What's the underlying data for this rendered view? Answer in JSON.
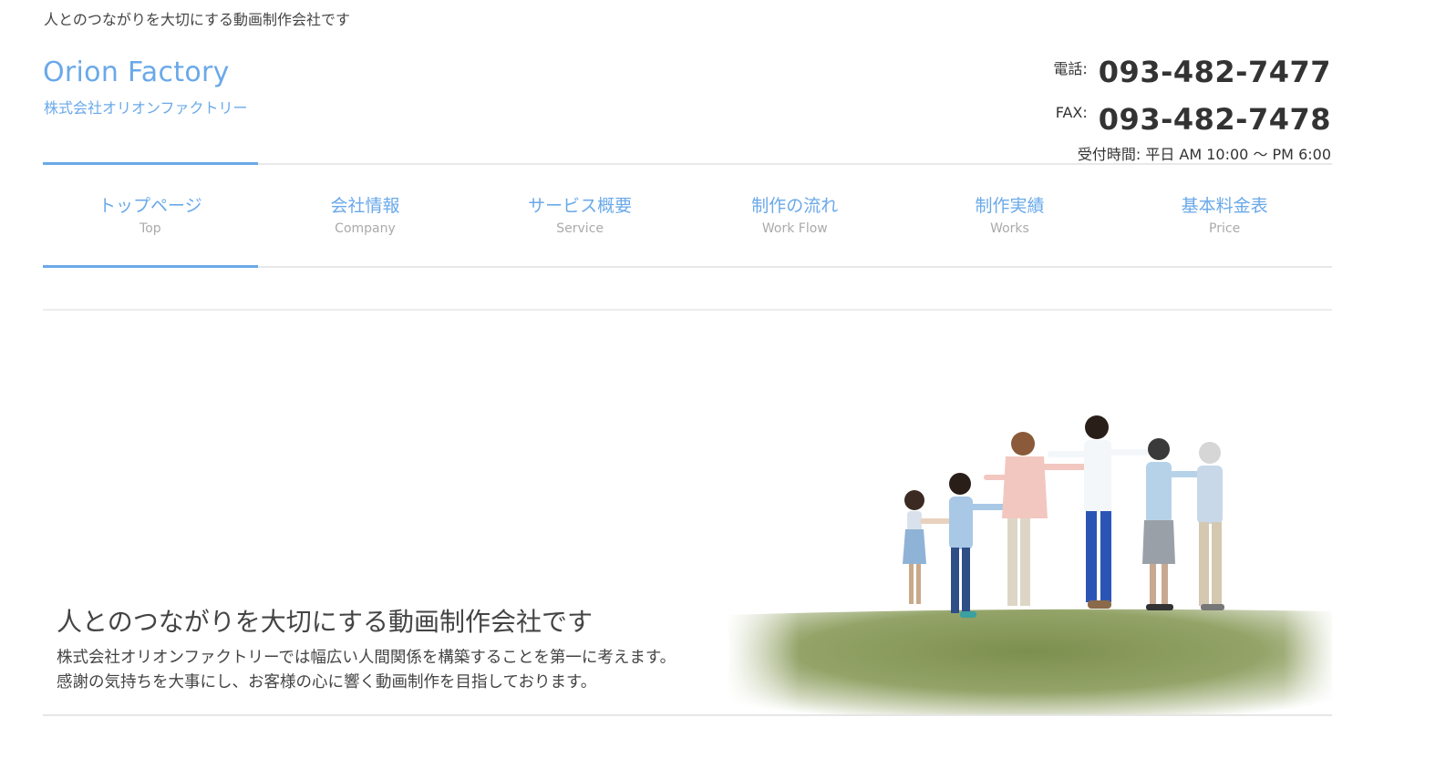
{
  "header": {
    "tagline": "人とのつながりを大切にする動画制作会社です",
    "logo_title": "Orion Factory",
    "logo_subtitle": "株式会社オリオンファクトリー",
    "phone_label": "電話:",
    "phone_number": "093-482-7477",
    "fax_label": "FAX:",
    "fax_number": "093-482-7478",
    "hours": "受付時間: 平日 AM 10:00 ～ PM 6:00"
  },
  "nav": {
    "items": [
      {
        "jp": "トップページ",
        "en": "Top",
        "active": true
      },
      {
        "jp": "会社情報",
        "en": "Company",
        "active": false
      },
      {
        "jp": "サービス概要",
        "en": "Service",
        "active": false
      },
      {
        "jp": "制作の流れ",
        "en": "Work Flow",
        "active": false
      },
      {
        "jp": "制作実績",
        "en": "Works",
        "active": false
      },
      {
        "jp": "基本料金表",
        "en": "Price",
        "active": false
      }
    ]
  },
  "hero": {
    "heading": "人とのつながりを大切にする動画制作会社です",
    "line1": "株式会社オリオンファクトリーでは幅広い人間関係を構築することを第一に考えます。",
    "line2": "感謝の気持ちを大事にし、お客様の心に響く動画制作を目指しております。"
  },
  "colors": {
    "accent": "#6aa9e9",
    "text": "#333333",
    "muted": "#aaaaaa",
    "grass": "#8a9a5b"
  }
}
